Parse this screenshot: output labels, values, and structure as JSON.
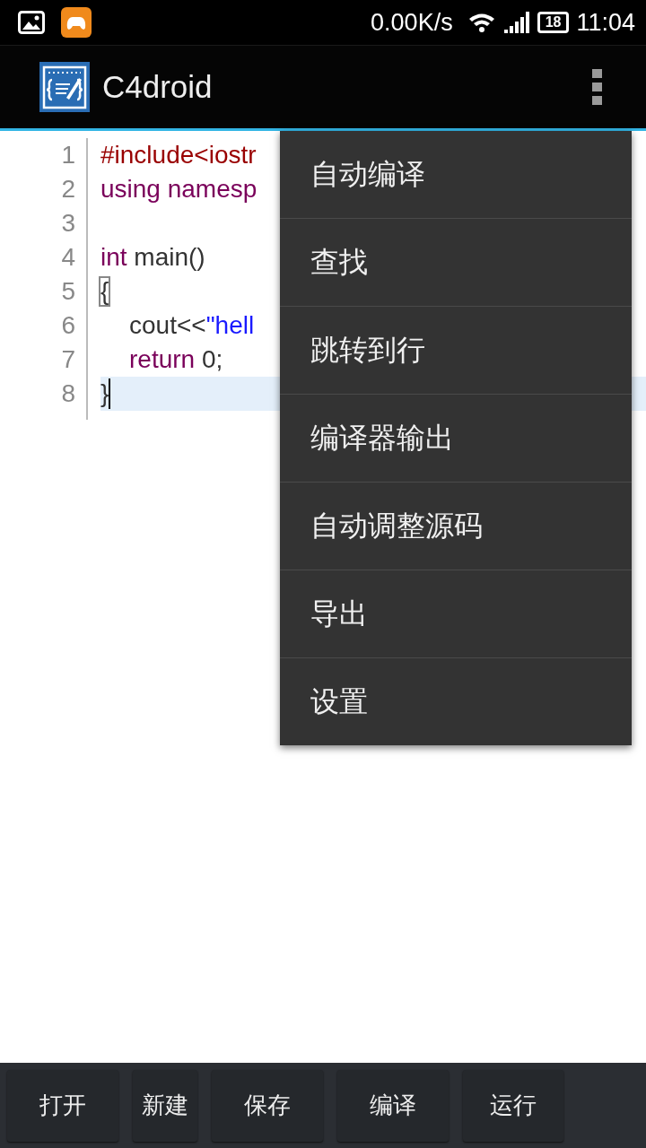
{
  "status_bar": {
    "speed": "0.00K/s",
    "battery": "18",
    "time": "11:04"
  },
  "app_bar": {
    "title": "C4droid"
  },
  "editor": {
    "lines": [
      {
        "number": "1",
        "indent": false,
        "highlighted": false,
        "bracket_match": false,
        "tokens": [
          {
            "kind": "preproc",
            "text": "#include<iostr"
          }
        ]
      },
      {
        "number": "2",
        "indent": false,
        "highlighted": false,
        "bracket_match": false,
        "tokens": [
          {
            "kind": "keyword",
            "text": "using namesp"
          }
        ]
      },
      {
        "number": "3",
        "highlighted": false
      },
      {
        "number": "4",
        "indent": false,
        "highlighted": false,
        "bracket_match": false,
        "tokens": [
          {
            "kind": "keyword",
            "text": "int"
          },
          {
            "kind": "plain",
            "text": " main()"
          }
        ]
      },
      {
        "number": "5",
        "indent": false,
        "highlighted": false,
        "bracket_match": true,
        "tokens": [
          {
            "kind": "plain",
            "text": "{"
          }
        ]
      },
      {
        "number": "6",
        "indent": true,
        "highlighted": false,
        "bracket_match": false,
        "tokens": [
          {
            "kind": "plain",
            "text": "cout<<"
          },
          {
            "kind": "string",
            "text": "\"hell"
          }
        ]
      },
      {
        "number": "7",
        "indent": true,
        "highlighted": false,
        "bracket_match": false,
        "tokens": [
          {
            "kind": "keyword",
            "text": "return"
          },
          {
            "kind": "plain",
            "text": " 0;"
          }
        ]
      },
      {
        "number": "8",
        "indent": false,
        "highlighted": true,
        "bracket_match": false,
        "tokens": [
          {
            "kind": "plain",
            "text": "}"
          }
        ]
      }
    ]
  },
  "menu": {
    "items": [
      "自动编译",
      "查找",
      "跳转到行",
      "编译器输出",
      "自动调整源码",
      "导出",
      "设置"
    ]
  },
  "bottom_buttons": [
    "打开",
    "新建",
    "保存",
    "编译",
    "运行"
  ]
}
